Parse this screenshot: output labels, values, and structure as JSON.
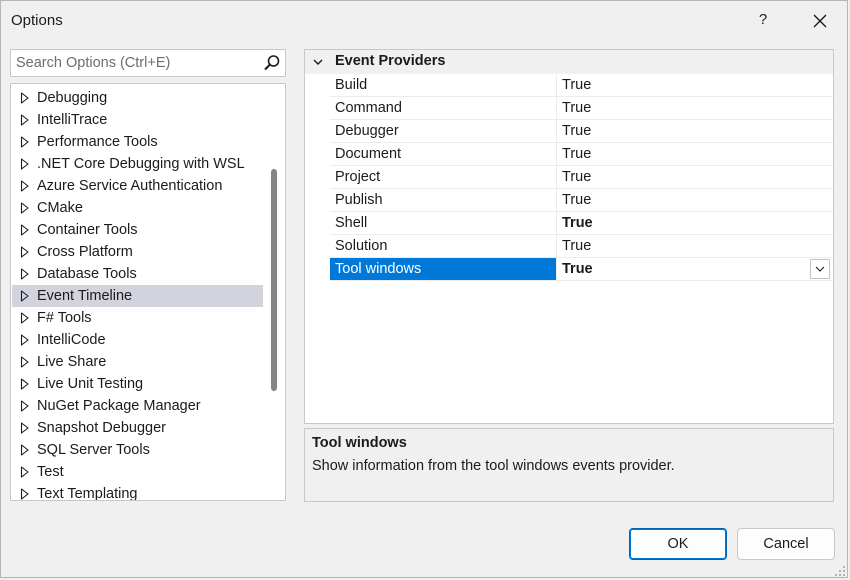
{
  "window": {
    "title": "Options",
    "help_label": "?"
  },
  "search": {
    "placeholder": "Search Options (Ctrl+E)",
    "value": ""
  },
  "tree": {
    "items": [
      {
        "label": "Debugging",
        "selected": false
      },
      {
        "label": "IntelliTrace",
        "selected": false
      },
      {
        "label": "Performance Tools",
        "selected": false
      },
      {
        "label": ".NET Core Debugging with WSL",
        "selected": false
      },
      {
        "label": "Azure Service Authentication",
        "selected": false
      },
      {
        "label": "CMake",
        "selected": false
      },
      {
        "label": "Container Tools",
        "selected": false
      },
      {
        "label": "Cross Platform",
        "selected": false
      },
      {
        "label": "Database Tools",
        "selected": false
      },
      {
        "label": "Event Timeline",
        "selected": true
      },
      {
        "label": "F# Tools",
        "selected": false
      },
      {
        "label": "IntelliCode",
        "selected": false
      },
      {
        "label": "Live Share",
        "selected": false
      },
      {
        "label": "Live Unit Testing",
        "selected": false
      },
      {
        "label": "NuGet Package Manager",
        "selected": false
      },
      {
        "label": "Snapshot Debugger",
        "selected": false
      },
      {
        "label": "SQL Server Tools",
        "selected": false
      },
      {
        "label": "Test",
        "selected": false
      },
      {
        "label": "Text Templating",
        "selected": false
      }
    ]
  },
  "grid": {
    "category": "Event Providers",
    "properties": [
      {
        "name": "Build",
        "value": "True",
        "bold": false,
        "selected": false
      },
      {
        "name": "Command",
        "value": "True",
        "bold": false,
        "selected": false
      },
      {
        "name": "Debugger",
        "value": "True",
        "bold": false,
        "selected": false
      },
      {
        "name": "Document",
        "value": "True",
        "bold": false,
        "selected": false
      },
      {
        "name": "Project",
        "value": "True",
        "bold": false,
        "selected": false
      },
      {
        "name": "Publish",
        "value": "True",
        "bold": false,
        "selected": false
      },
      {
        "name": "Shell",
        "value": "True",
        "bold": true,
        "selected": false
      },
      {
        "name": "Solution",
        "value": "True",
        "bold": false,
        "selected": false
      },
      {
        "name": "Tool windows",
        "value": "True",
        "bold": true,
        "selected": true
      }
    ]
  },
  "description": {
    "title": "Tool windows",
    "text": "Show information from the tool windows events provider."
  },
  "buttons": {
    "ok": "OK",
    "cancel": "Cancel"
  },
  "colors": {
    "selection_accent": "#0078d7",
    "tree_selection": "#d3d3de"
  }
}
